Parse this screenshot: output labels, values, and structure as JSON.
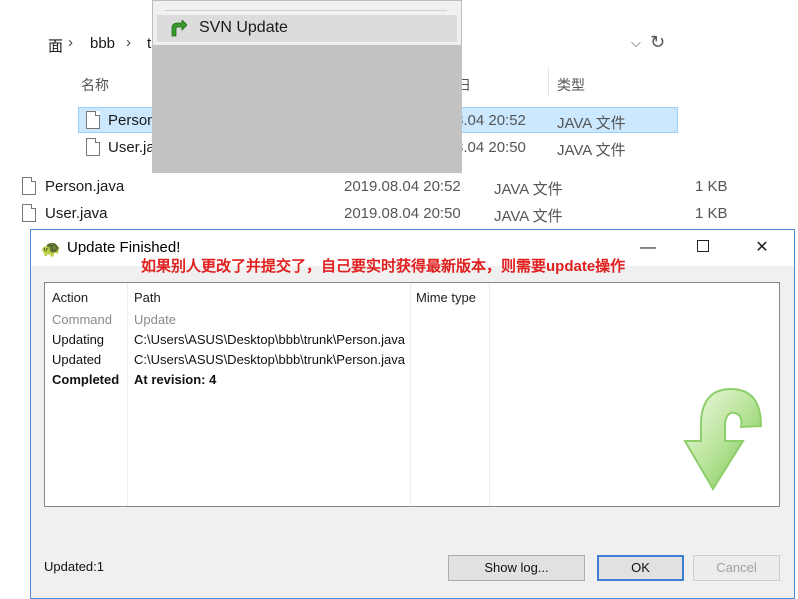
{
  "explorer": {
    "breadcrumb": [
      "面",
      "bbb",
      "t"
    ],
    "columns": {
      "name": "名称",
      "date_partial": "日",
      "type": "类型"
    },
    "files_selected_pane": [
      {
        "name": "Person",
        "date": "8.04 20:52",
        "type": "JAVA 文件",
        "selected": true
      },
      {
        "name": "User.ja",
        "date": "8.04 20:50",
        "type": "JAVA 文件",
        "selected": false
      }
    ],
    "files": [
      {
        "name": "Person.java",
        "date": "2019.08.04 20:52",
        "type": "JAVA 文件",
        "size": "1 KB"
      },
      {
        "name": "User.java",
        "date": "2019.08.04 20:50",
        "type": "JAVA 文件",
        "size": "1 KB"
      }
    ]
  },
  "context_menu": {
    "item_label": "SVN Update",
    "icon": "svn-update-icon"
  },
  "dialog": {
    "title": "Update Finished!",
    "annotation": "如果别人更改了并提交了，自己要实时获得最新版本，则需要update操作",
    "columns": [
      "Action",
      "Path",
      "Mime type"
    ],
    "rows": [
      {
        "action": "Command",
        "path": "Update",
        "style": "muted"
      },
      {
        "action": "Updating",
        "path": "C:\\Users\\ASUS\\Desktop\\bbb\\trunk\\Person.java",
        "style": "normal"
      },
      {
        "action": "Updated",
        "path": "C:\\Users\\ASUS\\Desktop\\bbb\\trunk\\Person.java",
        "style": "normal"
      },
      {
        "action": "Completed",
        "path": "At revision: 4",
        "style": "bold"
      }
    ],
    "status": "Updated:1",
    "buttons": {
      "show_log": "Show log...",
      "ok": "OK",
      "cancel": "Cancel"
    },
    "window_controls": {
      "minimize": "—",
      "close": "✕"
    },
    "colors": {
      "annotation": "#e0201f",
      "accent": "#3c7fd4",
      "arrow": "#7cc95a"
    }
  }
}
